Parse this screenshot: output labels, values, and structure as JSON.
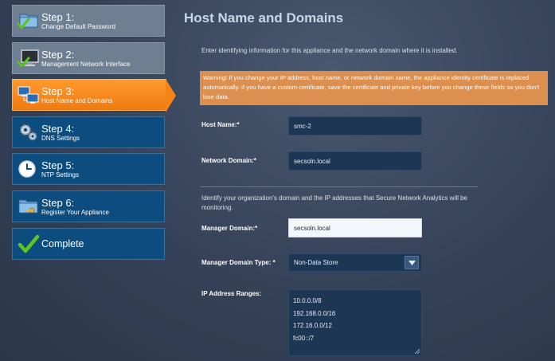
{
  "steps": [
    {
      "title": "Step 1:",
      "subtitle": "Change Default Password",
      "icon": "folder-check-icon",
      "state": "done"
    },
    {
      "title": "Step 2:",
      "subtitle": "Management Network Interface",
      "icon": "monitor-check-icon",
      "state": "done"
    },
    {
      "title": "Step 3:",
      "subtitle": "Host Name and Domains",
      "icon": "network-computers-icon",
      "state": "active"
    },
    {
      "title": "Step 4:",
      "subtitle": "DNS Settings",
      "icon": "gears-icon",
      "state": "pending"
    },
    {
      "title": "Step 5:",
      "subtitle": "NTP Settings",
      "icon": "clock-icon",
      "state": "pending"
    },
    {
      "title": "Step 6:",
      "subtitle": "Register Your Appliance",
      "icon": "folder-key-icon",
      "state": "pending"
    },
    {
      "title": "Complete",
      "subtitle": "",
      "icon": "checkmark-icon",
      "state": "pending"
    }
  ],
  "main": {
    "title": "Host Name and Domains",
    "intro": "Enter identifying information for this appliance and the network domain where it is installed.",
    "warning": "Warning! If you change your IP address, host name, or network domain name, the appliance identity certificate is replaced automatically. If you have a custom certificate, save the certificate and private key before you change these fields so you don't lose data.",
    "host_name": {
      "label": "Host Name:*",
      "value": "smc-2"
    },
    "network_domain": {
      "label": "Network Domain:*",
      "value": "secsoln.local"
    },
    "section_text": "Identify your organization's domain and the IP addresses that Secure Network Analytics will be monitoring.",
    "manager_domain": {
      "label": "Manager Domain:*",
      "value": "secsoln.local"
    },
    "manager_domain_type": {
      "label": "Manager Domain Type: *",
      "value": "Non-Data Store"
    },
    "ip_ranges": {
      "label": "IP Address Ranges:",
      "values": [
        "10.0.0.0/8",
        "192.168.0.0/16",
        "172.16.0.0/12",
        "fc00::/7"
      ]
    }
  },
  "colors": {
    "step_active": "#f48414",
    "step_done": "#6e7f93",
    "step_pending": "#0d4c7e",
    "warning_bg": "#dc8f4e",
    "check_green": "#5cc51f"
  }
}
